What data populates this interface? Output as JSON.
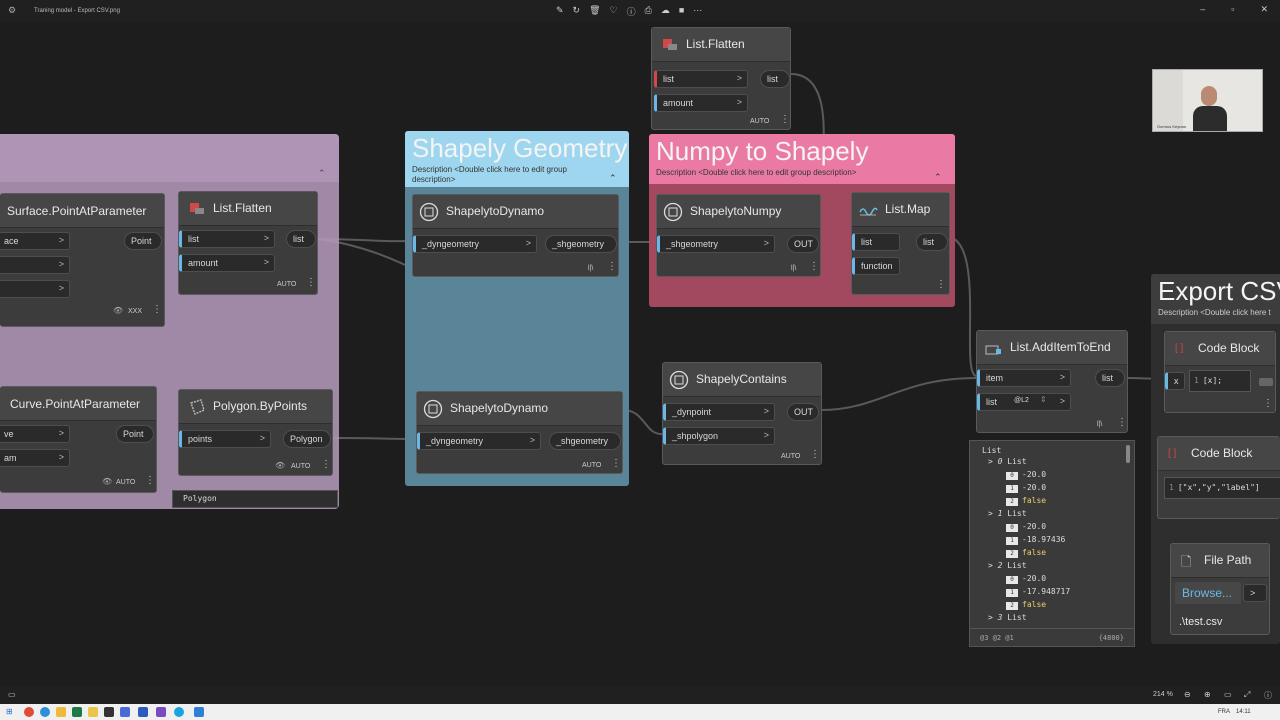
{
  "window": {
    "title": "Traning model - Export CSV.png"
  },
  "groups": {
    "shapely_geometry": {
      "title": "Shapely Geometry",
      "description": "Description <Double click here to edit group description>",
      "color": "#9fd6ef"
    },
    "numpy_to_shapely": {
      "title": "Numpy to Shapely",
      "description": "Description <Double click here to edit group description>",
      "color": "#ea7aa4"
    },
    "export_csv": {
      "title": "Export CSV",
      "description": "Description <Double click here t"
    },
    "left_group": {
      "color": "#c9a9d1"
    }
  },
  "nodes": {
    "list_flatten_top": {
      "title": "List.Flatten",
      "in1": "list",
      "in2": "amount",
      "out1": "list",
      "lacing": "AUTO"
    },
    "surface_pap": {
      "title": "Surface.PointAtParameter",
      "in1": "ace",
      "out1": "Point",
      "lacing": "XXX"
    },
    "list_flatten_left": {
      "title": "List.Flatten",
      "in1": "list",
      "in2": "amount",
      "out1": "list",
      "lacing": "AUTO"
    },
    "curve_pap": {
      "title": "Curve.PointAtParameter",
      "in1": "ve",
      "in2": "am",
      "out1": "Point",
      "lacing": "AUTO"
    },
    "polygon_bypoints": {
      "title": "Polygon.ByPoints",
      "in1": "points",
      "out1": "Polygon",
      "lacing": "AUTO",
      "preview": "Polygon"
    },
    "shapely_to_dynamo_1": {
      "title": "ShapelytoDynamo",
      "in1": "_dyngeometry",
      "out1": "_shgeometry",
      "lacing": "l|\\"
    },
    "shapely_to_dynamo_2": {
      "title": "ShapelytoDynamo",
      "in1": "_dyngeometry",
      "out1": "_shgeometry",
      "lacing": "AUTO"
    },
    "shapely_to_numpy": {
      "title": "ShapelytoNumpy",
      "in1": "_shgeometry",
      "out1": "OUT",
      "lacing": "l|\\"
    },
    "list_map": {
      "title": "List.Map",
      "in1": "list",
      "in2": "function",
      "out1": "list"
    },
    "shapely_contains": {
      "title": "ShapelyContains",
      "in1": "_dynpoint",
      "in2": "_shpolygon",
      "out1": "OUT",
      "lacing": "AUTO"
    },
    "list_additemtoend": {
      "title": "List.AddItemToEnd",
      "in1": "item",
      "in2": "list",
      "level": "@L2",
      "out1": "list",
      "lacing": "l|\\"
    },
    "code_block_1": {
      "title": "Code Block",
      "port": "x",
      "line": "1",
      "code": "[x];"
    },
    "code_block_2": {
      "title": "Code Block",
      "line": "1",
      "code": "[\"x\",\"y\",\"label\"]"
    },
    "file_path": {
      "title": "File Path",
      "button": "Browse...",
      "value": ".\\test.csv"
    }
  },
  "preview": {
    "root": "List",
    "groups": [
      {
        "index": "0",
        "label": "List",
        "items": [
          [
            "0",
            "-20.0"
          ],
          [
            "1",
            "-20.0"
          ],
          [
            "2",
            "false"
          ]
        ]
      },
      {
        "index": "1",
        "label": "List",
        "items": [
          [
            "0",
            "-20.0"
          ],
          [
            "1",
            "-18.97436"
          ],
          [
            "2",
            "false"
          ]
        ]
      },
      {
        "index": "2",
        "label": "List",
        "items": [
          [
            "0",
            "-20.0"
          ],
          [
            "1",
            "-17.948717"
          ],
          [
            "2",
            "false"
          ]
        ]
      },
      {
        "index": "3",
        "label": "List",
        "items": []
      }
    ],
    "levels": "@3 @2 @1",
    "count": "{4800}"
  },
  "webcam": {
    "caption": "Ourmus Keyram"
  },
  "status": {
    "zoom": "214 %"
  },
  "taskbar": {
    "lang": "FRA",
    "time": "14:11"
  }
}
